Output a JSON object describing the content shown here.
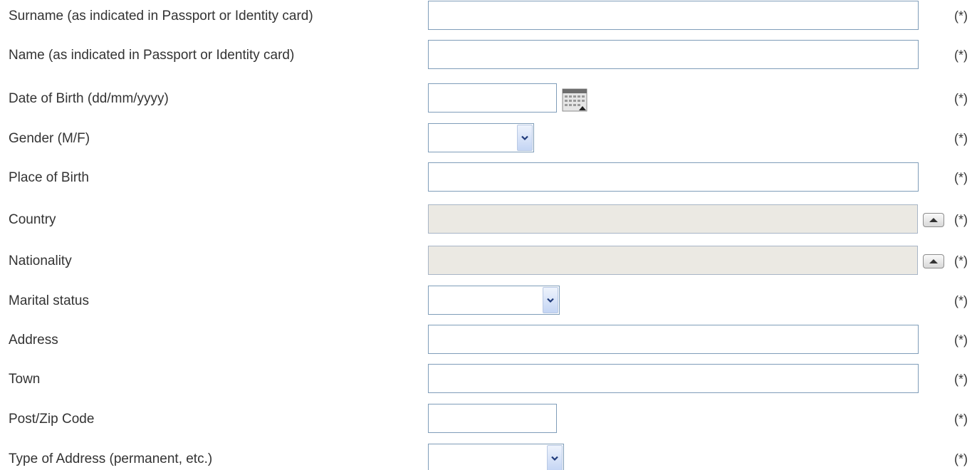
{
  "required_marker": "(*)",
  "fields": {
    "surname": {
      "label": "Surname (as indicated in Passport or Identity card)",
      "value": ""
    },
    "name": {
      "label": "Name (as indicated in Passport or Identity card)",
      "value": ""
    },
    "dob": {
      "label": "Date of Birth (dd/mm/yyyy)",
      "value": "",
      "picker_icon": "calendar-icon"
    },
    "gender": {
      "label": "Gender (M/F)",
      "selected": ""
    },
    "place_of_birth": {
      "label": "Place of Birth",
      "value": ""
    },
    "country": {
      "label": "Country",
      "value": "",
      "button_icon": "triangle-up-icon"
    },
    "nationality": {
      "label": "Nationality",
      "value": "",
      "button_icon": "triangle-up-icon"
    },
    "marital_status": {
      "label": "Marital status",
      "selected": ""
    },
    "address": {
      "label": "Address",
      "value": ""
    },
    "town": {
      "label": "Town",
      "value": ""
    },
    "post_code": {
      "label": "Post/Zip Code",
      "value": ""
    },
    "address_type": {
      "label": "Type of Address (permanent, etc.)",
      "selected": ""
    }
  },
  "colors": {
    "input_border": "#7f9db9",
    "disabled_background": "#ebe9e3",
    "label_text": "#333333"
  }
}
